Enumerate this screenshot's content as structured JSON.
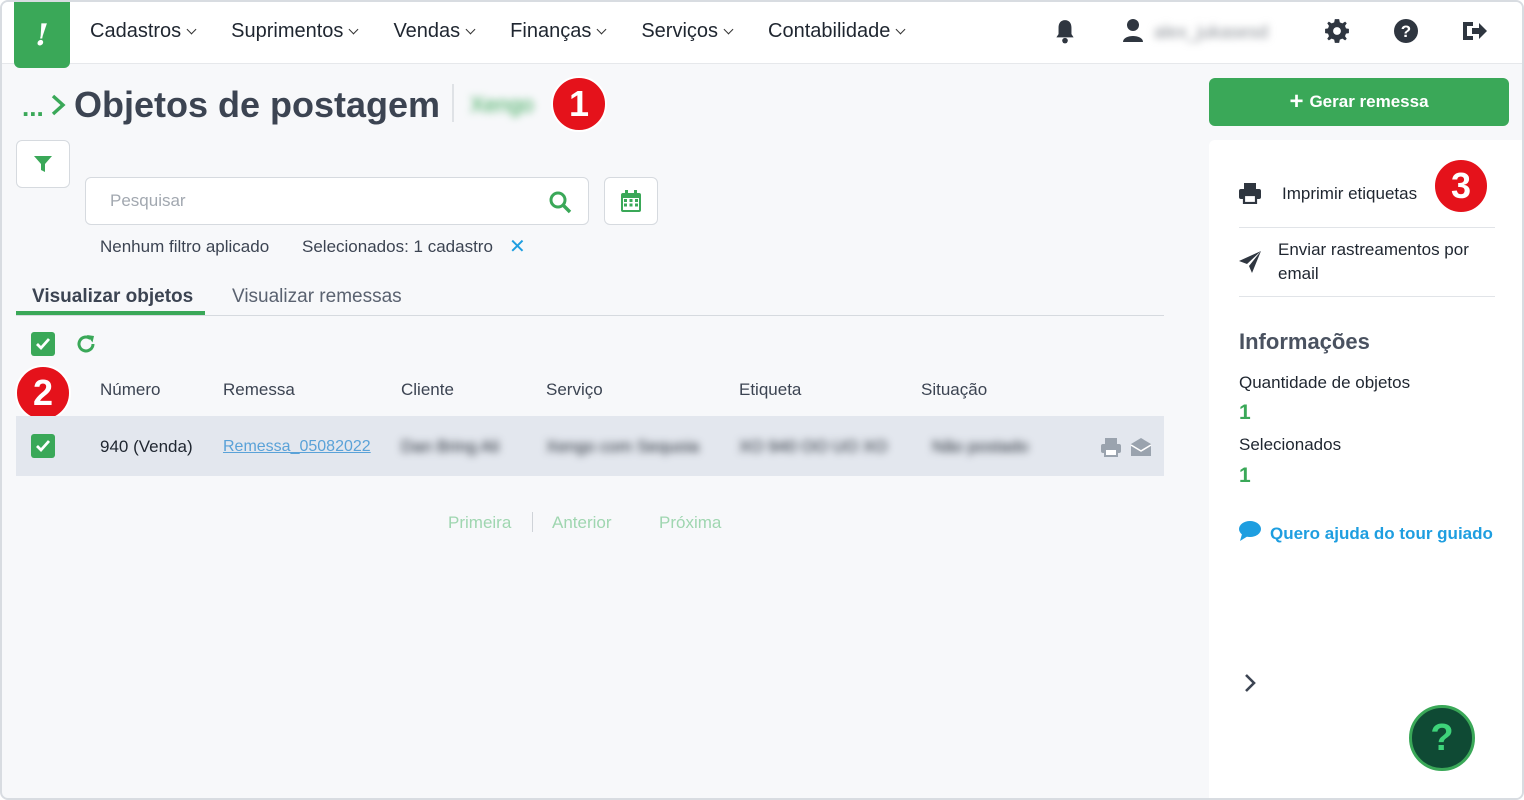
{
  "nav": {
    "logo": "!",
    "menu": [
      {
        "label": "Cadastros"
      },
      {
        "label": "Suprimentos"
      },
      {
        "label": "Vendas"
      },
      {
        "label": "Finanças"
      },
      {
        "label": "Serviços"
      },
      {
        "label": "Contabilidade"
      }
    ],
    "user_name": "alex_jukasesd"
  },
  "header": {
    "breadcrumb_dots": "...",
    "title": "Objetos de postagem",
    "tag": "Xengo"
  },
  "search": {
    "placeholder": "Pesquisar",
    "filter_status": "Nenhum filtro aplicado",
    "selected_status": "Selecionados: 1 cadastro",
    "clear": "✕"
  },
  "tabs": [
    {
      "label": "Visualizar objetos",
      "active": true
    },
    {
      "label": "Visualizar remessas",
      "active": false
    }
  ],
  "table": {
    "columns": [
      "Número",
      "Remessa",
      "Cliente",
      "Serviço",
      "Etiqueta",
      "Situação"
    ],
    "rows": [
      {
        "numero": "940 (Venda)",
        "remessa": "Remessa_05082022",
        "cliente": "Dan Bring Ali",
        "servico": "Xengo com Sequoia",
        "etiqueta": "XO 940 OO UO XO",
        "situacao": "Não postado",
        "checked": true
      }
    ]
  },
  "pager": {
    "first": "Primeira",
    "prev": "Anterior",
    "next": "Próxima"
  },
  "sidebar": {
    "generate_button": "Gerar remessa",
    "actions": [
      {
        "label": "Imprimir etiquetas"
      },
      {
        "label_line1": "Enviar rastreamentos por",
        "label_line2": "email"
      }
    ],
    "info_title": "Informações",
    "info": [
      {
        "label": "Quantidade de objetos",
        "value": "1"
      },
      {
        "label": "Selecionados",
        "value": "1"
      }
    ],
    "tour": "Quero ajuda do tour guiado",
    "help": "?"
  },
  "annotations": [
    "1",
    "2",
    "3"
  ],
  "colors": {
    "brand_green": "#3aa858",
    "badge_red": "#e5121b",
    "link_blue": "#1e9ee0"
  }
}
